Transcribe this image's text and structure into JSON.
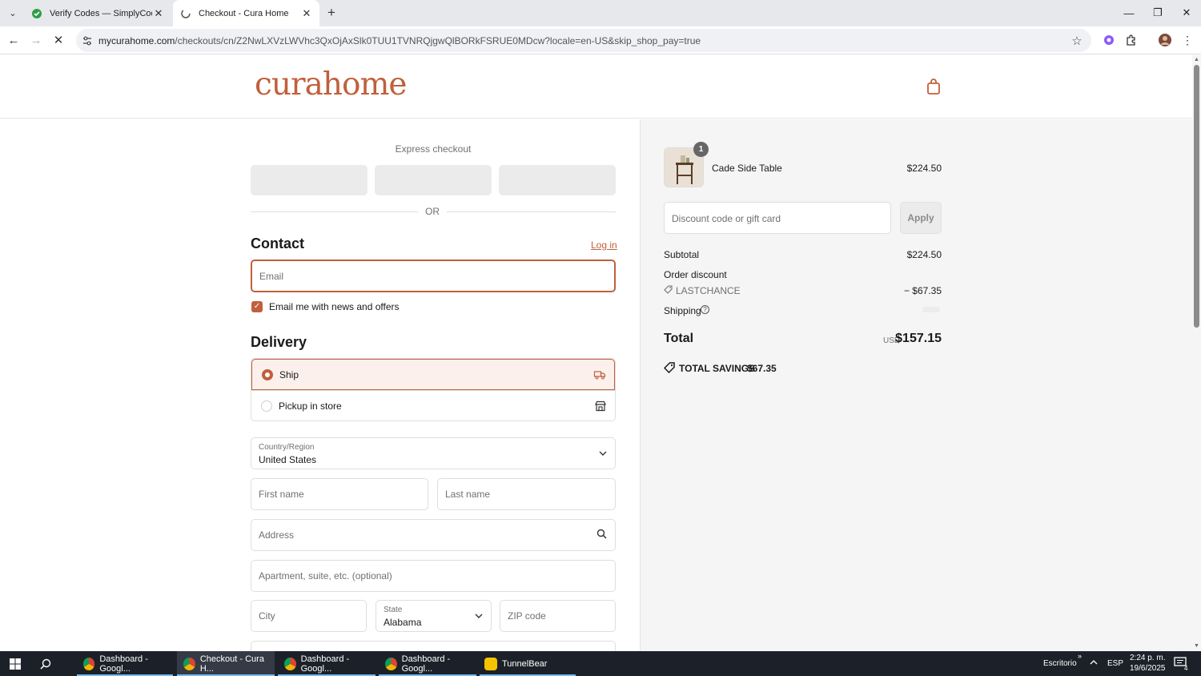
{
  "browser": {
    "tabs": [
      {
        "title": "Verify Codes — SimplyCodes",
        "active": false
      },
      {
        "title": "Checkout - Cura Home",
        "active": true
      }
    ],
    "url_host": "mycurahome.com",
    "url_path": "/checkouts/cn/Z2NwLXVzLWVhc3QxOjAxSlk0TUU1TVNRQjgwQlBORkFSRUE0MDcw?locale=en-US&skip_shop_pay=true"
  },
  "header": {
    "logo_text": "curahome"
  },
  "express": {
    "title": "Express checkout",
    "or_text": "OR"
  },
  "contact": {
    "heading": "Contact",
    "login_label": "Log in",
    "email_placeholder": "Email",
    "newsletter_label": "Email me with news and offers",
    "newsletter_checked": true
  },
  "delivery": {
    "heading": "Delivery",
    "options": [
      {
        "label": "Ship",
        "selected": true
      },
      {
        "label": "Pickup in store",
        "selected": false
      }
    ],
    "country_label": "Country/Region",
    "country_value": "United States",
    "first_name_placeholder": "First name",
    "last_name_placeholder": "Last name",
    "address_placeholder": "Address",
    "apartment_placeholder": "Apartment, suite, etc. (optional)",
    "city_placeholder": "City",
    "state_label": "State",
    "state_value": "Alabama",
    "zip_placeholder": "ZIP code"
  },
  "summary": {
    "item": {
      "name": "Cade Side Table",
      "price": "$224.50",
      "quantity": "1"
    },
    "discount_placeholder": "Discount code or gift card",
    "apply_label": "Apply",
    "subtotal_label": "Subtotal",
    "subtotal_value": "$224.50",
    "order_discount_label": "Order discount",
    "discount_code": "LASTCHANCE",
    "discount_value": "− $67.35",
    "shipping_label": "Shipping",
    "total_label": "Total",
    "currency": "USD",
    "total_value": "$157.15",
    "savings_label": "TOTAL SAVINGS",
    "savings_value": "$67.35"
  },
  "taskbar": {
    "items": [
      {
        "label": "Dashboard - Googl...",
        "active": false
      },
      {
        "label": "Checkout - Cura H...",
        "active": true
      },
      {
        "label": "Dashboard - Googl...",
        "active": false
      },
      {
        "label": "Dashboard - Googl...",
        "active": false
      },
      {
        "label": "TunnelBear",
        "active": false
      }
    ],
    "desktop_label": "Escritorio",
    "language": "ESP",
    "time": "2:24 p. m.",
    "date": "19/6/2025",
    "notification_count": "4"
  },
  "colors": {
    "accent": "#c0603c",
    "accent_light": "#fbf0ec",
    "panel_bg": "#f5f5f5"
  }
}
